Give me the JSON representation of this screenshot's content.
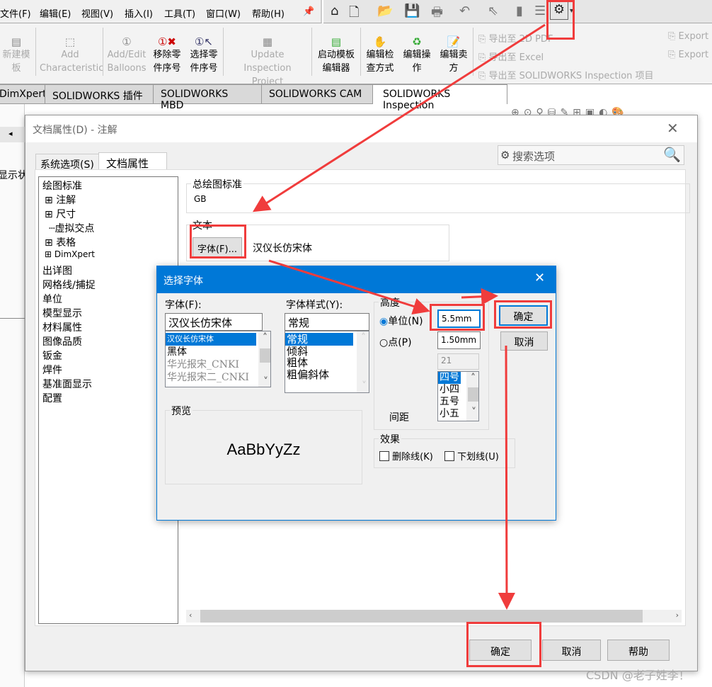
{
  "menu": [
    "文件(F)",
    "编辑(E)",
    "视图(V)",
    "插入(I)",
    "工具(T)",
    "窗口(W)",
    "帮助(H)"
  ],
  "quick_icons": [
    "home-icon",
    "new-icon",
    "open-icon",
    "save-icon",
    "print-icon",
    "undo-icon",
    "select-icon",
    "rebuild-icon",
    "file-props-icon",
    "options-gear-icon"
  ],
  "ribbon": {
    "items": [
      {
        "label1": "新建模",
        "label2": "板",
        "enabled": false
      },
      {
        "label1": "Add",
        "label2": "Characteristic",
        "enabled": false
      },
      {
        "label1": "Add/Edit",
        "label2": "Balloons",
        "enabled": false
      },
      {
        "label1": "移除零",
        "label2": "件序号",
        "enabled": true
      },
      {
        "label1": "选择零",
        "label2": "件序号",
        "enabled": true
      },
      {
        "label1": "Update Inspection",
        "label2": "Project",
        "enabled": false
      },
      {
        "label1": "启动模板",
        "label2": "编辑器",
        "enabled": true
      },
      {
        "label1": "编辑检",
        "label2": "查方式",
        "enabled": true
      },
      {
        "label1": "编辑操",
        "label2": "作",
        "enabled": true
      },
      {
        "label1": "编辑卖",
        "label2": "方",
        "enabled": true
      }
    ],
    "exports": [
      "导出至 2D PDF",
      "导出至 Excel",
      "导出至 SOLIDWORKS Inspection 项目",
      "Export",
      "Export"
    ]
  },
  "tabs": [
    "DimXpert",
    "SOLIDWORKS 插件",
    "SOLIDWORKS MBD",
    "SOLIDWORKS CAM",
    "SOLIDWORKS Inspection"
  ],
  "left_strip": {
    "text": "显示状"
  },
  "doc_props": {
    "title": "文档属性(D) - 注解",
    "tabs": [
      "系统选项(S)",
      "文档属性(D)"
    ],
    "search_placeholder": "搜索选项",
    "tree": [
      "绘图标准",
      "注解",
      "尺寸",
      "虚拟交点",
      "表格",
      "DimXpert",
      "出详图",
      "网格线/捕捉",
      "单位",
      "模型显示",
      "材料属性",
      "图像品质",
      "钣金",
      "焊件",
      "基准面显示",
      "配置"
    ],
    "standard_group": "总绘图标准",
    "standard_value": "GB",
    "text_group": "文本",
    "font_button": "字体(F)...",
    "font_value": "汉仪长仿宋体",
    "buttons": {
      "ok": "确定",
      "cancel": "取消",
      "help": "帮助"
    }
  },
  "font_dialog": {
    "title": "选择字体",
    "font_label": "字体(F):",
    "font_value": "汉仪长仿宋体",
    "font_list": [
      "汉仪长仿宋体",
      "黑体",
      "华光报宋_CNKI",
      "华光报宋二_CNKI"
    ],
    "style_label": "字体样式(Y):",
    "style_value": "常规",
    "style_list": [
      "常规",
      "倾斜",
      "粗体",
      "粗偏斜体"
    ],
    "height_group": "高度",
    "unit_radio": "单位(N)",
    "unit_value": "5.5mm",
    "unit_selected": true,
    "point_radio": "点(P)",
    "point_value": "1.50mm",
    "point_size": "21",
    "size_list": [
      "四号",
      "小四",
      "五号",
      "小五"
    ],
    "spacing_label": "间距",
    "effects_group": "效果",
    "strikeout": "删除线(K)",
    "underline": "下划线(U)",
    "strikeout_checked": false,
    "underline_checked": false,
    "preview_group": "预览",
    "preview_text": "AaBbYyZz",
    "ok": "确定",
    "cancel": "取消"
  },
  "watermark": "CSDN @老子姓李！",
  "colors": {
    "accent": "#0078d7",
    "annotation": "#f03c3c"
  }
}
